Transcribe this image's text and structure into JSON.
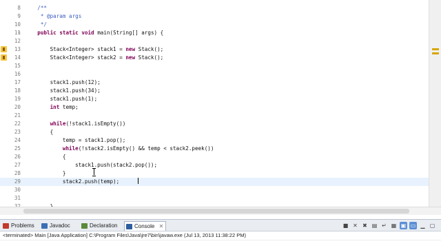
{
  "editor": {
    "lines": [
      {
        "num": "8",
        "fold": "",
        "text": "    /**",
        "kind": "comment"
      },
      {
        "num": "9",
        "fold": "",
        "text": "     * @param args",
        "kind": "comment"
      },
      {
        "num": "10",
        "fold": "",
        "text": "     */",
        "kind": "comment"
      },
      {
        "num": "11",
        "fold": "⊖",
        "text": "    public static void main(String[] args) {",
        "kind": "code"
      },
      {
        "num": "12",
        "fold": "",
        "text": "",
        "kind": "code"
      },
      {
        "num": "13",
        "fold": "",
        "text": "        Stack<Integer> stack1 = new Stack();",
        "kind": "code",
        "marker": "warning"
      },
      {
        "num": "14",
        "fold": "",
        "text": "        Stack<Integer> stack2 = new Stack();",
        "kind": "code",
        "marker": "warning"
      },
      {
        "num": "15",
        "fold": "",
        "text": "",
        "kind": "code"
      },
      {
        "num": "16",
        "fold": "",
        "text": "",
        "kind": "code"
      },
      {
        "num": "17",
        "fold": "",
        "text": "        stack1.push(12);",
        "kind": "code"
      },
      {
        "num": "18",
        "fold": "",
        "text": "        stack1.push(34);",
        "kind": "code"
      },
      {
        "num": "19",
        "fold": "",
        "text": "        stack1.push(1);",
        "kind": "code"
      },
      {
        "num": "20",
        "fold": "",
        "text": "        int temp;",
        "kind": "code"
      },
      {
        "num": "21",
        "fold": "",
        "text": "",
        "kind": "code"
      },
      {
        "num": "22",
        "fold": "",
        "text": "        while(!stack1.isEmpty())",
        "kind": "code"
      },
      {
        "num": "23",
        "fold": "",
        "text": "        {",
        "kind": "code"
      },
      {
        "num": "24",
        "fold": "",
        "text": "            temp = stack1.pop();",
        "kind": "code"
      },
      {
        "num": "25",
        "fold": "",
        "text": "            while(!stack2.isEmpty() && temp < stack2.peek())",
        "kind": "code"
      },
      {
        "num": "26",
        "fold": "",
        "text": "            {",
        "kind": "code"
      },
      {
        "num": "27",
        "fold": "",
        "text": "                stack1.push(stack2.pop());",
        "kind": "code"
      },
      {
        "num": "28",
        "fold": "",
        "text": "            }",
        "kind": "code"
      },
      {
        "num": "29",
        "fold": "",
        "text": "            stack2.push(temp);",
        "kind": "code",
        "current": true
      },
      {
        "num": "30",
        "fold": "",
        "text": "",
        "kind": "code"
      },
      {
        "num": "31",
        "fold": "",
        "text": "",
        "kind": "code"
      },
      {
        "num": "32",
        "fold": "",
        "text": "        }",
        "kind": "code"
      }
    ],
    "keywords": [
      "public",
      "static",
      "void",
      "new",
      "int",
      "while"
    ]
  },
  "panel": {
    "tabs": [
      {
        "label": "Problems",
        "icon": "problems-icon",
        "color": "#c0392b"
      },
      {
        "label": "Javadoc",
        "icon": "javadoc-icon",
        "color": "#3a6fb5"
      },
      {
        "label": "Declaration",
        "icon": "declaration-icon",
        "color": "#5a8a3a"
      },
      {
        "label": "Console",
        "icon": "console-icon",
        "color": "#2d5fa0",
        "active": true
      }
    ],
    "close_glyph": "✕",
    "toolbar_icons": [
      "terminate-icon",
      "remove-launch-icon",
      "remove-all-icon",
      "scroll-lock-icon",
      "word-wrap-icon",
      "pin-console-icon",
      "display-console-icon",
      "open-console-icon",
      "minimize-icon",
      "maximize-icon"
    ],
    "console_header": "<terminated> Main [Java Application] C:\\Program Files\\Java\\jre7\\bin\\javaw.exe (Jul 13, 2013 11:38:22 PM)"
  },
  "colors": {
    "keyword": "#7f0055",
    "comment": "#3f5fbf",
    "current_line": "#e8f2fe",
    "warning": "#f4c542"
  }
}
